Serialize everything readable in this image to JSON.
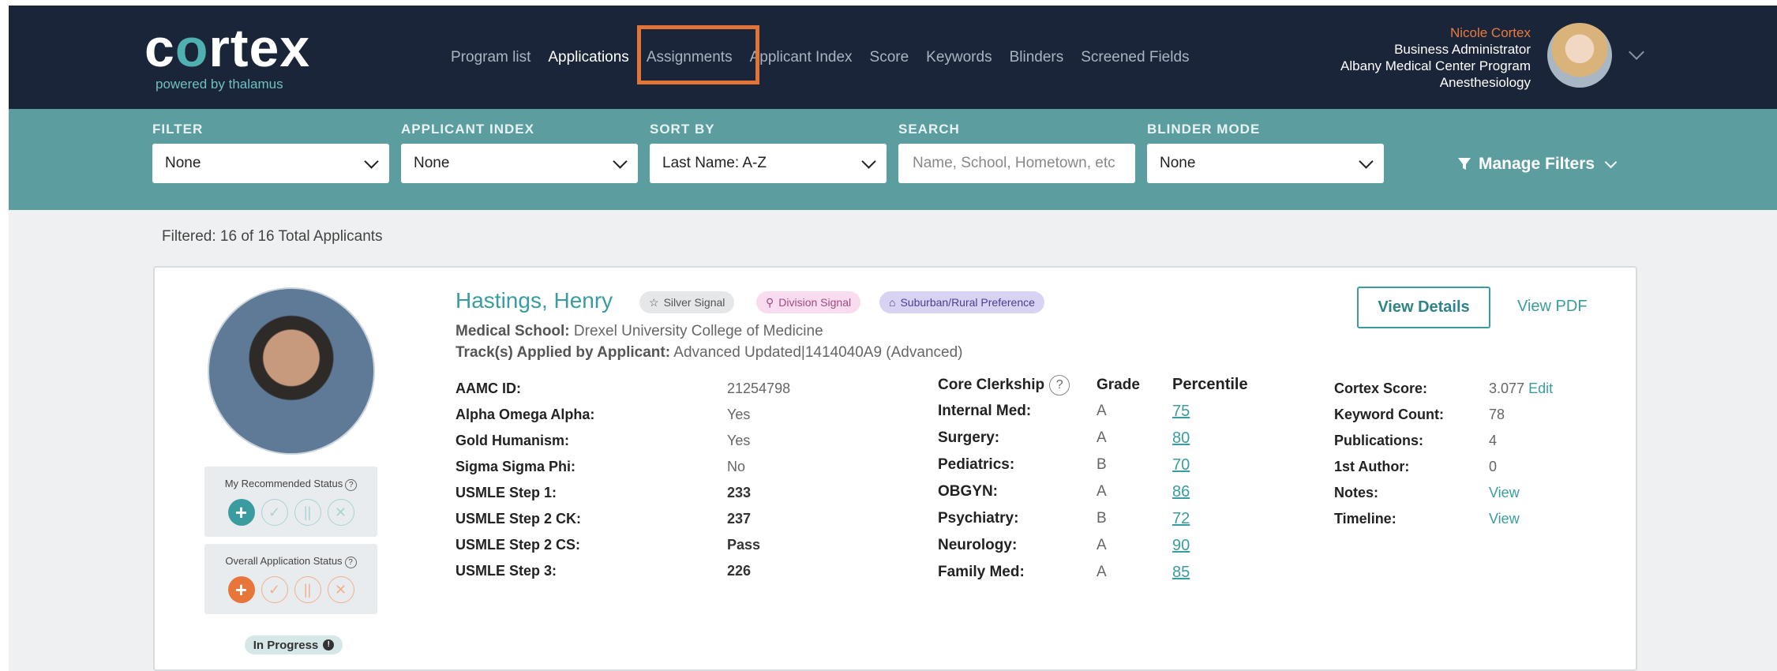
{
  "brand": {
    "logo": "cortex",
    "tagline": "powered by thalamus"
  },
  "nav": {
    "items": [
      "Program list",
      "Applications",
      "Assignments",
      "Applicant Index",
      "Score",
      "Keywords",
      "Blinders",
      "Screened Fields"
    ],
    "active": "Applications"
  },
  "user": {
    "name": "Nicole Cortex",
    "role": "Business Administrator",
    "program": "Albany Medical Center Program",
    "specialty": "Anesthesiology"
  },
  "filters": {
    "filter": {
      "label": "FILTER",
      "value": "None"
    },
    "applicant_index": {
      "label": "APPLICANT INDEX",
      "value": "None"
    },
    "sort_by": {
      "label": "SORT BY",
      "value": "Last Name: A-Z"
    },
    "search": {
      "label": "SEARCH",
      "placeholder": "Name, School, Hometown, etc"
    },
    "blinder_mode": {
      "label": "BLINDER MODE",
      "value": "None"
    },
    "manage_filters": "Manage Filters"
  },
  "summary": "Filtered: 16 of 16 Total Applicants",
  "applicant": {
    "name": "Hastings, Henry",
    "badges": [
      "Silver Signal",
      "Division Signal",
      "Suburban/Rural Preference"
    ],
    "medical_school_label": "Medical School:",
    "medical_school": "Drexel University College of Medicine",
    "tracks_label": "Track(s) Applied by Applicant:",
    "tracks": "Advanced Updated|1414040A9 (Advanced)",
    "my_status_title": "My Recommended Status",
    "overall_status_title": "Overall Application Status",
    "progress": "In Progress",
    "view_details": "View Details",
    "view_pdf": "View PDF",
    "info": [
      {
        "label": "AAMC ID:",
        "value": "21254798"
      },
      {
        "label": "Alpha Omega Alpha:",
        "value": "Yes"
      },
      {
        "label": "Gold Humanism:",
        "value": "Yes"
      },
      {
        "label": "Sigma Sigma Phi:",
        "value": "No"
      },
      {
        "label": "USMLE Step 1:",
        "value": "233"
      },
      {
        "label": "USMLE Step 2 CK:",
        "value": "237"
      },
      {
        "label": "USMLE Step 2 CS:",
        "value": "Pass"
      },
      {
        "label": "USMLE Step 3:",
        "value": "226"
      }
    ],
    "clerkship_headers": {
      "name": "Core Clerkship",
      "grade": "Grade",
      "percentile": "Percentile"
    },
    "clerkships": [
      {
        "name": "Internal Med:",
        "grade": "A",
        "percentile": "75"
      },
      {
        "name": "Surgery:",
        "grade": "A",
        "percentile": "80"
      },
      {
        "name": "Pediatrics:",
        "grade": "B",
        "percentile": "70"
      },
      {
        "name": "OBGYN:",
        "grade": "A",
        "percentile": "86"
      },
      {
        "name": "Psychiatry:",
        "grade": "B",
        "percentile": "72"
      },
      {
        "name": "Neurology:",
        "grade": "A",
        "percentile": "90"
      },
      {
        "name": "Family Med:",
        "grade": "A",
        "percentile": "85"
      }
    ],
    "scores": [
      {
        "label": "Cortex Score:",
        "value": "3.077",
        "link": "Edit"
      },
      {
        "label": "Keyword Count:",
        "value": "78"
      },
      {
        "label": "Publications:",
        "value": "4"
      },
      {
        "label": "1st Author:",
        "value": "0"
      },
      {
        "label": "Notes:",
        "link": "View"
      },
      {
        "label": "Timeline:",
        "link": "View"
      }
    ]
  },
  "colors": {
    "header_bg": "#1b2539",
    "filter_bg": "#5c9ea0",
    "accent_teal": "#3a9c9e",
    "accent_orange": "#e8753a",
    "highlight": "#e27438"
  }
}
